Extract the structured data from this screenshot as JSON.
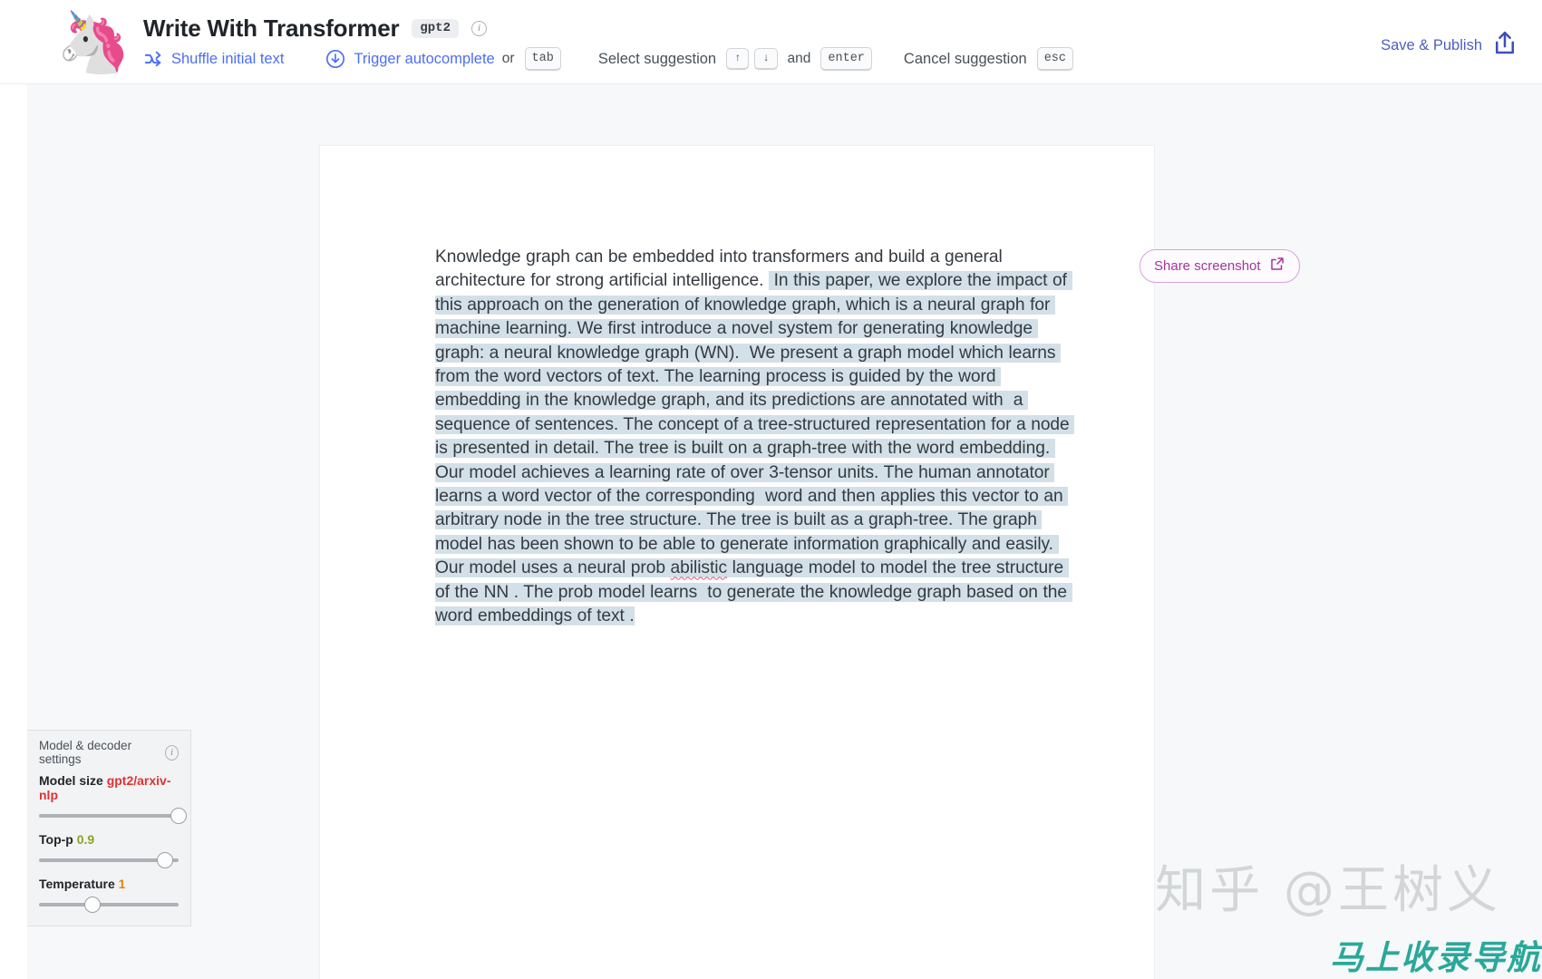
{
  "header": {
    "logo_icon": "unicorn-emoji",
    "title": "Write With Transformer",
    "model_chip": "gpt2",
    "info_icon": "info-circle-icon",
    "shortcuts": {
      "shuffle_icon": "shuffle-icon",
      "shuffle_label": "Shuffle initial text",
      "autocomplete_icon": "download-arrow-icon",
      "autocomplete_label": "Trigger autocomplete",
      "or_word": "or",
      "tab_key": "tab",
      "select_label": "Select suggestion",
      "up_key": "↑",
      "down_key": "↓",
      "and_word": "and",
      "enter_key": "enter",
      "cancel_label": "Cancel suggestion",
      "esc_key": "esc"
    },
    "save_publish_label": "Save & Publish",
    "save_publish_icon": "upload-share-icon"
  },
  "editor": {
    "prompt_text": "Knowledge graph can be embedded into transformers and build a general architecture for strong artificial intelligence. ",
    "generated_text_a": " In this paper, we explore the impact of this approach on the generation of knowledge graph, which is a neural graph for machine learning. We first introduce a novel system for generating knowledge graph: a neural knowledge graph (WN).  We present a graph model which learns from the word vectors of text. The learning process is guided by the word embedding in the knowledge graph, and its predictions are annotated with  a sequence of sentences. The concept of a tree-structured representation for a node is presented in detail. The tree is built on a graph-tree with the word embedding. Our model achieves a learning rate of over 3-tensor units. The human annotator learns a word vector of the corresponding  word and then applies this vector to an arbitrary node in the tree structure. The tree is built as a graph-tree. The graph model has been shown to be able to generate information graphically and easily. Our model uses a neural prob ",
    "misspelled_word": "abilistic",
    "generated_text_b": " language model to model the tree structure of the NN . The prob model learns  to generate the knowledge graph based on the word embeddings of text ."
  },
  "share": {
    "label": "Share screenshot",
    "icon": "external-link-icon",
    "color": "#a3359f"
  },
  "settings": {
    "panel_title": "Model & decoder settings",
    "info_icon": "info-circle-icon",
    "controls": [
      {
        "label": "Model size",
        "value": "gpt2/arxiv-nlp",
        "value_color": "#e03131",
        "knob_percent": 100
      },
      {
        "label": "Top-p",
        "value": "0.9",
        "value_color": "#8aa32a",
        "knob_percent": 90
      },
      {
        "label": "Temperature",
        "value": "1",
        "value_color": "#e8820c",
        "knob_percent": 38
      }
    ]
  },
  "watermarks": {
    "zhihu": "知乎 @王树义",
    "nav": "马上收录导航"
  }
}
